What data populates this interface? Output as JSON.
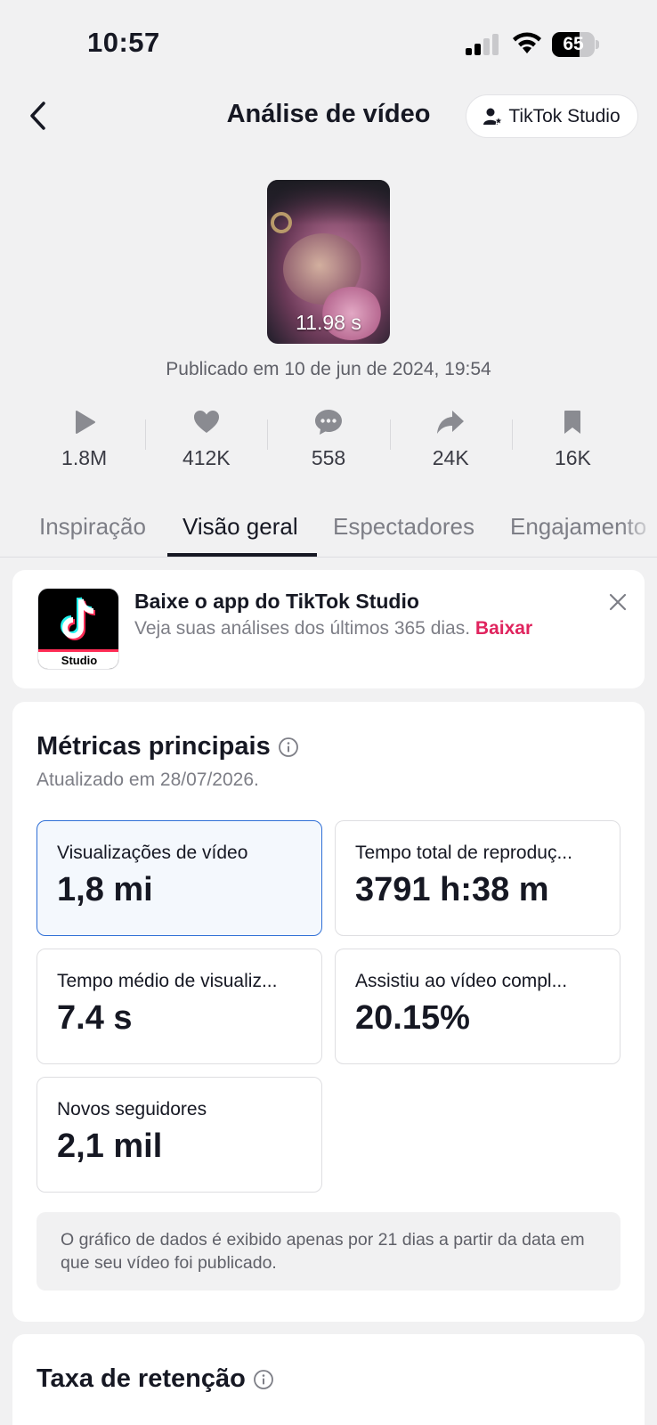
{
  "status_bar": {
    "time": "10:57",
    "battery": "65",
    "battery_level": 0.65
  },
  "header": {
    "title": "Análise de vídeo",
    "studio_button": "TikTok Studio"
  },
  "video": {
    "duration": "11.98 s",
    "published": "Publicado em 10 de jun de 2024, 19:54"
  },
  "stats": [
    {
      "icon": "play-icon",
      "value": "1.8M"
    },
    {
      "icon": "heart-icon",
      "value": "412K"
    },
    {
      "icon": "comment-icon",
      "value": "558"
    },
    {
      "icon": "share-icon",
      "value": "24K"
    },
    {
      "icon": "bookmark-icon",
      "value": "16K"
    }
  ],
  "tabs": [
    {
      "label": "Inspiração",
      "active": false
    },
    {
      "label": "Visão geral",
      "active": true
    },
    {
      "label": "Espectadores",
      "active": false
    },
    {
      "label": "Engajamento",
      "active": false
    }
  ],
  "banner": {
    "app_label": "Studio",
    "title": "Baixe o app do TikTok Studio",
    "subtitle": "Veja suas análises dos últimos 365 dias.",
    "link": "Baixar"
  },
  "metrics": {
    "title": "Métricas principais",
    "updated": "Atualizado em 28/07/2026.",
    "cards": [
      {
        "label": "Visualizações de vídeo",
        "value": "1,8 mi",
        "selected": true
      },
      {
        "label": "Tempo total de reproduç...",
        "value": "3791 h:38 m",
        "selected": false
      },
      {
        "label": "Tempo médio de visualiz...",
        "value": "7.4 s",
        "selected": false
      },
      {
        "label": "Assistiu ao vídeo compl...",
        "value": "20.15%",
        "selected": false
      },
      {
        "label": "Novos seguidores",
        "value": "2,1 mil",
        "selected": false
      }
    ],
    "note": "O gráfico de dados é exibido apenas por 21 dias a partir da data em que seu vídeo foi publicado."
  },
  "retention": {
    "title": "Taxa de retenção"
  },
  "colors": {
    "accent": "#fe2c55",
    "link": "#e0245e",
    "selected_border": "#2f6fd6",
    "text": "#161823",
    "muted": "#7d7e86"
  }
}
